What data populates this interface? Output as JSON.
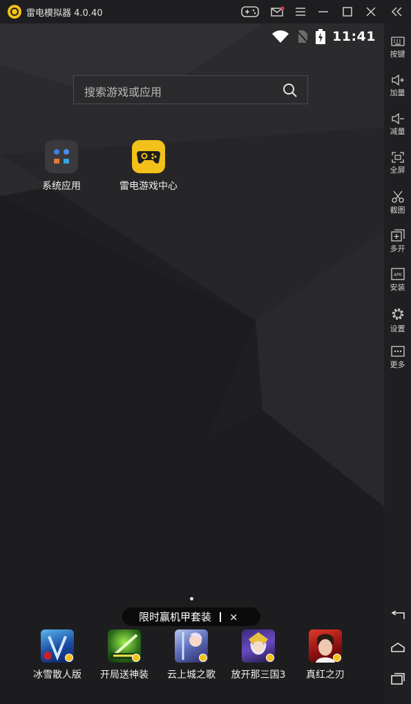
{
  "window": {
    "title": "雷电模拟器 4.0.40",
    "controls": [
      "gamepad-icon",
      "mail-icon",
      "menu-icon",
      "minimize-icon",
      "maximize-icon",
      "close-icon",
      "collapse-sidebar-icon"
    ]
  },
  "statusbar": {
    "time": "11:41",
    "icons": [
      "wifi-icon",
      "no-sim-icon",
      "battery-charging-icon"
    ]
  },
  "search": {
    "placeholder": "搜索游戏或应用"
  },
  "desktop_apps": [
    {
      "label": "系统应用",
      "icon": "system-apps-folder-icon"
    },
    {
      "label": "雷电游戏中心",
      "icon": "game-center-icon"
    }
  ],
  "promo": {
    "text": "限时赢机甲套装",
    "close": "×"
  },
  "dock_apps": [
    {
      "label": "冰雪散人版",
      "icon": "bingxue-game-icon"
    },
    {
      "label": "开局送神装",
      "icon": "shenzhuang-game-icon"
    },
    {
      "label": "云上城之歌",
      "icon": "yunshangcheng-game-icon"
    },
    {
      "label": "放开那三国3",
      "icon": "sanguo-game-icon"
    },
    {
      "label": "真红之刃",
      "icon": "zhenhong-game-icon"
    }
  ],
  "sidebar": {
    "items": [
      {
        "label": "按键",
        "icon": "keyboard-icon"
      },
      {
        "label": "加量",
        "icon": "volume-up-icon"
      },
      {
        "label": "减量",
        "icon": "volume-down-icon"
      },
      {
        "label": "全屏",
        "icon": "fullscreen-icon"
      },
      {
        "label": "截图",
        "icon": "scissors-icon"
      },
      {
        "label": "多开",
        "icon": "multi-instance-icon"
      },
      {
        "label": "安装",
        "icon": "apk-install-icon"
      },
      {
        "label": "设置",
        "icon": "gear-icon"
      },
      {
        "label": "更多",
        "icon": "more-icon"
      }
    ],
    "nav": [
      "back-icon",
      "home-icon",
      "recent-apps-icon"
    ]
  },
  "colors": {
    "brand_yellow": "#f2c11a",
    "background": "#202022",
    "sidebar": "#1f1f21"
  }
}
